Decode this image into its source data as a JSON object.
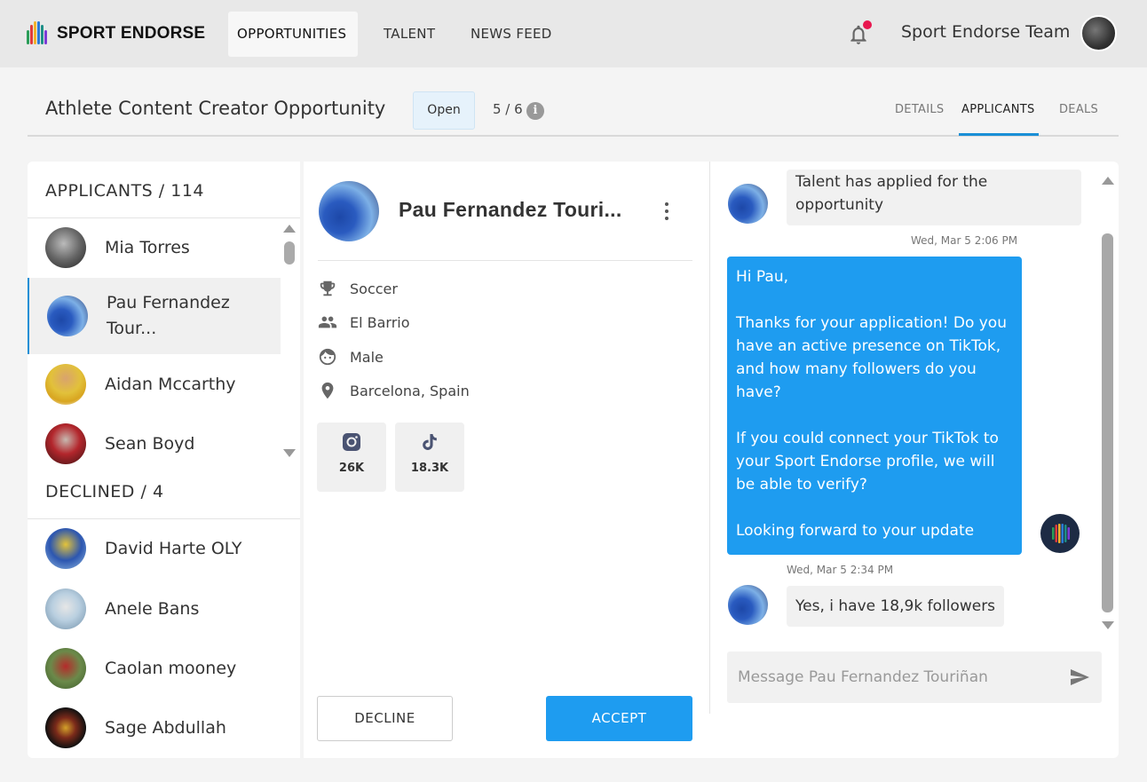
{
  "brand": {
    "name": "SPORT ENDORSE",
    "logo_bar_colors": [
      "#2a9d58",
      "#e03b3b",
      "#f2b32b",
      "#2b7bd6",
      "#1d8f86",
      "#7c3bd6"
    ]
  },
  "nav": {
    "items": [
      {
        "label": "OPPORTUNITIES",
        "active": true
      },
      {
        "label": "TALENT",
        "active": false
      },
      {
        "label": "NEWS FEED",
        "active": false
      }
    ],
    "user_name": "Sport Endorse Team",
    "notification_icon": "bell-icon"
  },
  "opportunity": {
    "title": "Athlete Content Creator Opportunity",
    "status": "Open",
    "count": "5 / 6",
    "info_glyph": "i",
    "tabs": [
      {
        "label": "DETAILS",
        "active": false
      },
      {
        "label": "APPLICANTS",
        "active": true
      },
      {
        "label": "DEALS",
        "active": false
      }
    ]
  },
  "applicants": {
    "title": "APPLICANTS",
    "separator": "/",
    "total": "114",
    "items": [
      {
        "name": "Mia Torres",
        "selected": false
      },
      {
        "name": "Pau Fernandez Tour...",
        "selected": true
      },
      {
        "name": "Aidan Mccarthy",
        "selected": false
      },
      {
        "name": "Sean Boyd",
        "selected": false
      }
    ]
  },
  "declined": {
    "title": "DECLINED",
    "separator": "/",
    "total": "4",
    "items": [
      {
        "name": "David Harte OLY"
      },
      {
        "name": "Anele Bans"
      },
      {
        "name": "Caolan mooney"
      },
      {
        "name": "Sage Abdullah"
      }
    ]
  },
  "profile": {
    "name": "Pau Fernandez Touri...",
    "sport": "Soccer",
    "club": "El Barrio",
    "gender": "Male",
    "location": "Barcelona, Spain",
    "socials": [
      {
        "network_icon": "instagram-icon",
        "followers": "26K"
      },
      {
        "network_icon": "tiktok-icon",
        "followers": "18.3K"
      }
    ],
    "decline_label": "DECLINE",
    "accept_label": "ACCEPT"
  },
  "chat": {
    "messages": [
      {
        "from": "talent",
        "text": "Talent has applied for the opportunity"
      },
      {
        "from": "team",
        "time": "Wed, Mar 5 2:06 PM",
        "text": "Hi Pau,\n\nThanks for your application! Do you have an active presence on TikTok, and how many followers do you have?\n\nIf you could connect your TikTok to your Sport Endorse profile, we will be able to verify?\n\nLooking forward to your update"
      },
      {
        "from": "talent",
        "time": "Wed, Mar 5 2:34 PM",
        "text": "Yes, i have 18,9k followers"
      }
    ],
    "input_placeholder": "Message Pau Fernandez Touriñan"
  },
  "colors": {
    "accent": "#1e9cf0",
    "tab_underline": "#1a8fd6",
    "notification_dot": "#e8174f",
    "badge_bg": "#e6f2fb"
  }
}
